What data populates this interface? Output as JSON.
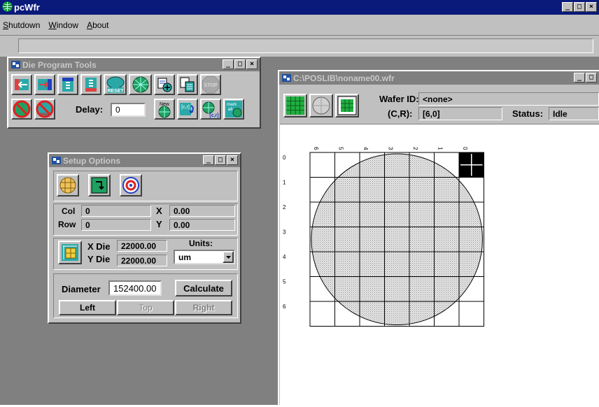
{
  "app": {
    "title": "pcWfr",
    "menu": [
      {
        "pre": "",
        "u": "S",
        "post": "hutdown"
      },
      {
        "pre": "",
        "u": "W",
        "post": "indow"
      },
      {
        "pre": "",
        "u": "A",
        "post": "bout"
      }
    ]
  },
  "die_tools": {
    "title": "Die Program Tools",
    "delay_label": "Delay:",
    "delay_value": "0",
    "icons": [
      "move-left-icon",
      "move-right-icon",
      "step-down-icon",
      "step-up-icon",
      "reset-icon",
      "wafer-map-icon",
      "program-plus-icon",
      "program-copy-icon",
      "stop-icon",
      "no-go-icon",
      "no-delay-icon",
      "new-wafer-icon",
      "col-row-icon",
      "col-row-query-icon",
      "col-row-wafer-icon",
      "mark-all-icon"
    ],
    "reset_label": "RESET",
    "stop_label": "STOP",
    "new_label": "New",
    "cr_label": "[c,r]",
    "mark_label_1": "mark",
    "mark_label_2": "all",
    "delay_text": "delay"
  },
  "setup": {
    "title": "Setup Options",
    "col_label": "Col",
    "col_value": "0",
    "row_label": "Row",
    "row_value": "0",
    "x_label": "X",
    "x_value": "0.00",
    "y_label": "Y",
    "y_value": "0.00",
    "xdie_label": "X Die",
    "xdie_value": "22000.00",
    "ydie_label": "Y Die",
    "ydie_value": "22000.00",
    "units_label": "Units:",
    "units_value": "um",
    "diameter_label": "Diameter",
    "diameter_value": "152400.00",
    "calculate_label": "Calculate",
    "left_label": "Left",
    "top_label": "Top",
    "right_label": "Right"
  },
  "wafer": {
    "title": "C:\\POSLIB\\noname00.wfr",
    "wafer_id_label": "Wafer ID:",
    "wafer_id_value": "<none>",
    "cr_label": "(C,R):",
    "cr_value": "[6,0]",
    "status_label": "Status:",
    "status_value": "Idle",
    "col_labels": [
      "6",
      "5",
      "4",
      "3",
      "2",
      "1",
      "0"
    ],
    "row_labels": [
      "0",
      "1",
      "2",
      "3",
      "4",
      "5",
      "6"
    ],
    "selected_die": {
      "col": "0",
      "row": "0"
    }
  },
  "colors": {
    "title_active": "#0a1a7a",
    "title_inactive": "#808080",
    "face": "#c0c0c0",
    "desktop": "#808080",
    "wafer_fill": "#d0d0d0",
    "tool_teal": "#2aa8a8"
  }
}
